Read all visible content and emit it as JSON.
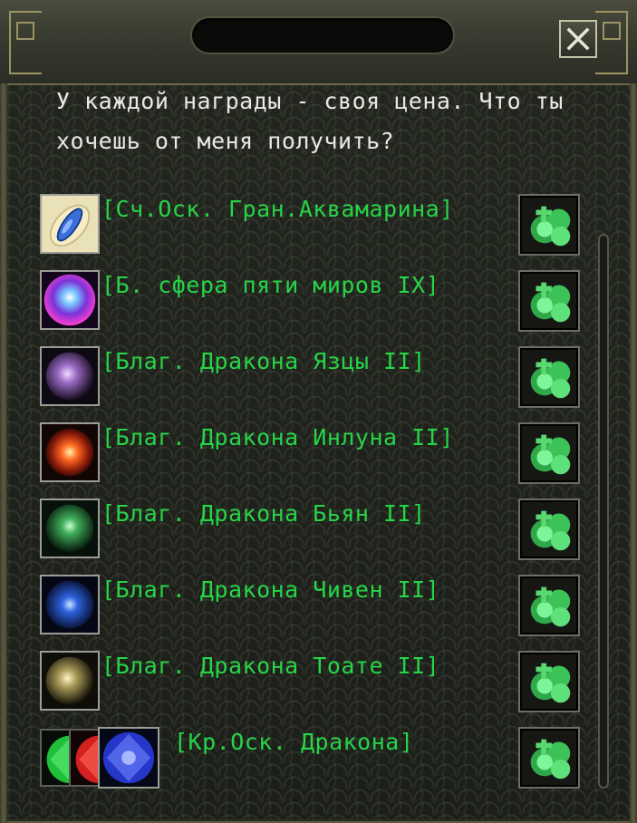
{
  "dialog": {
    "greeting": "У каждой награды - своя цена. Что ты\nхочешь от меня получить?"
  },
  "rewards": [
    {
      "label": "[Сч.Оск. Гран.Аквамарина]",
      "icon": "aquamarine-shard-icon"
    },
    {
      "label": "[Б. сфера пяти миров IX]",
      "icon": "five-worlds-sphere-icon"
    },
    {
      "label": "[Благ. Дракона Язцы II]",
      "icon": "dragon-orb-purple-icon"
    },
    {
      "label": "[Благ. Дракона Инлуна II]",
      "icon": "dragon-orb-red-icon"
    },
    {
      "label": "[Благ. Дракона Бьян II]",
      "icon": "dragon-orb-green-icon"
    },
    {
      "label": "[Благ. Дракона Чивен II]",
      "icon": "dragon-orb-blue-icon"
    },
    {
      "label": "[Благ. Дракона Тоате II]",
      "icon": "dragon-orb-gold-icon"
    },
    {
      "label": "[Кр.Оск. Дракона]",
      "icon": "dragon-crystal-shards-icon"
    }
  ],
  "colors": {
    "item_text": "#27d448",
    "dialog_text": "#e9e9e4",
    "frame_gold": "#9a9362"
  }
}
